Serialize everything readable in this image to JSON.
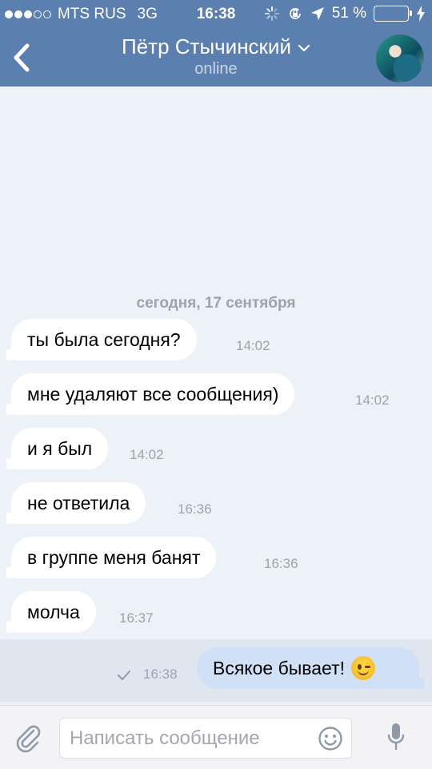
{
  "status": {
    "carrier": "MTS RUS",
    "network": "3G",
    "time": "16:38",
    "battery": "51 %",
    "battery_level": 0.51,
    "signal_bars": 3,
    "signal_total": 5
  },
  "header": {
    "title": "Пётр Стычинский",
    "subtitle": "online",
    "accent": "#5b7faf"
  },
  "chat": {
    "date": "сегодня, 17 сентября",
    "messages": [
      {
        "text": "ты была сегодня?",
        "time": "14:02",
        "direction": "in"
      },
      {
        "text": "мне удаляют все сообщения)",
        "time": "14:02",
        "direction": "in"
      },
      {
        "text": "и я был",
        "time": "14:02",
        "direction": "in"
      },
      {
        "text": "не ответила",
        "time": "16:36",
        "direction": "in"
      },
      {
        "text": "в группе меня банят",
        "time": "16:36",
        "direction": "in"
      },
      {
        "text": "молча",
        "time": "16:37",
        "direction": "in"
      }
    ],
    "outgoing": {
      "text": "Всякое бывает!",
      "time": "16:38",
      "emoji": "winking-face",
      "status": "sent"
    }
  },
  "input": {
    "placeholder": "Написать сообщение",
    "value": ""
  },
  "icons": {
    "back": "chevron-left",
    "title_dropdown": "chevron-down",
    "attach": "paperclip",
    "emoji": "smiley",
    "mic": "microphone"
  }
}
